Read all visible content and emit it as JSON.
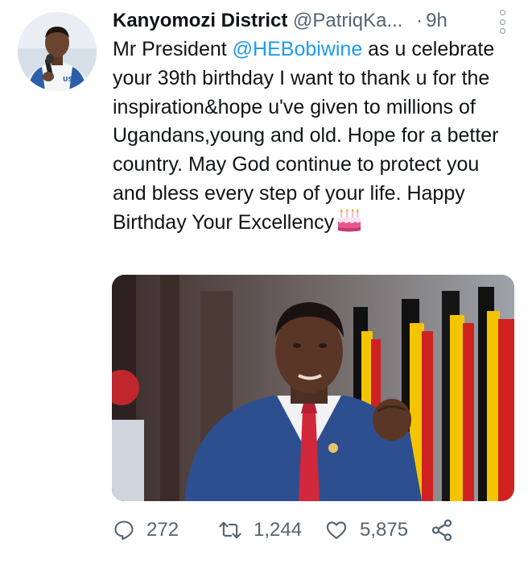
{
  "tweet": {
    "author_name": "Kanyomozi District",
    "author_handle": "@PatriqKa...",
    "separator": "·",
    "timestamp": "9h",
    "text_before_mention": "Mr President ",
    "mention": "@HEBobiwine",
    "text_after_mention": " as u celebrate your 39th birthday I want to thank u for the inspiration&hope u've given to millions of Ugandans,young and old. Hope for a better country. May God continue to protect you and bless every step of your life. Happy Birthday Your Excellency",
    "emoji": "birthday-cake-emoji"
  },
  "avatar_shirt_text": "USEN",
  "actions": {
    "replies": "272",
    "retweets": "1,244",
    "likes": "5,875"
  },
  "icons": {
    "reply": "reply-icon",
    "retweet": "retweet-icon",
    "like": "heart-icon",
    "share": "share-icon",
    "more": "more-options-icon"
  },
  "colors": {
    "text": "#0f1419",
    "secondary": "#536471",
    "link": "#1d9bf0"
  }
}
